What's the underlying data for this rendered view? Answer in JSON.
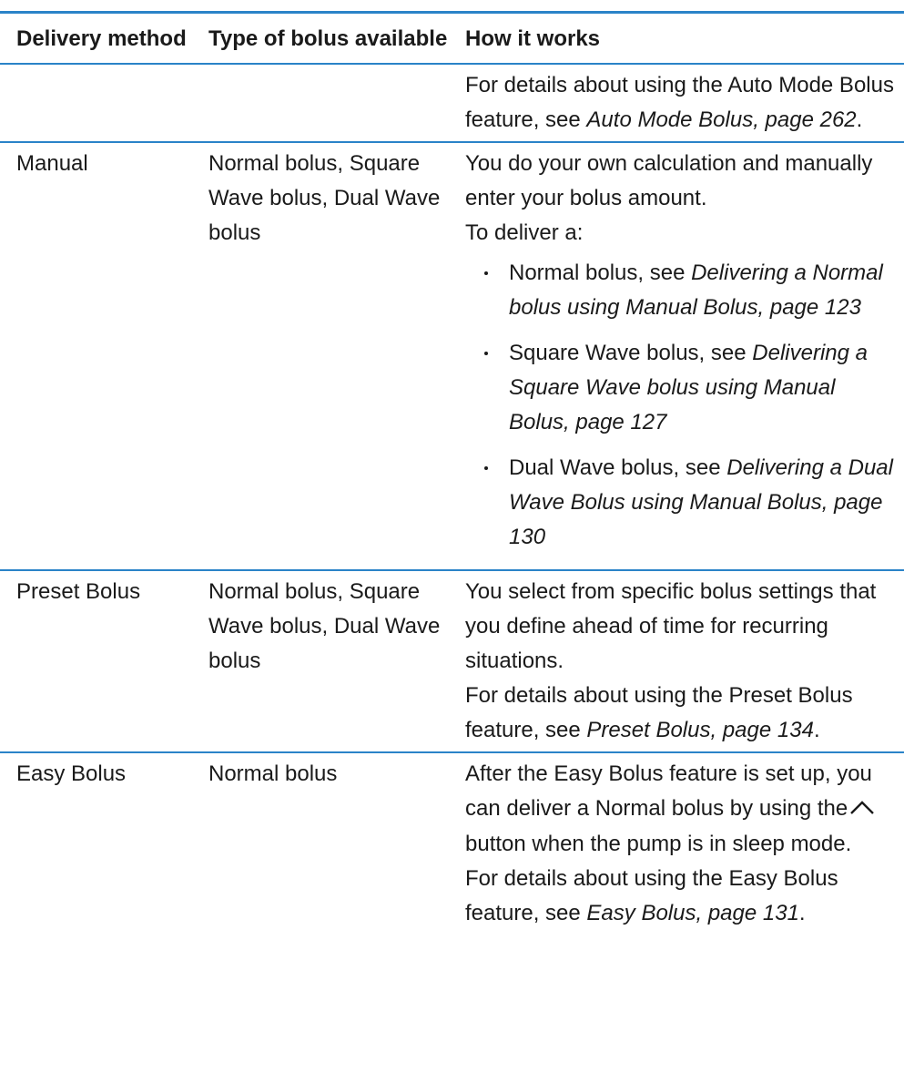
{
  "headers": [
    "Delivery method",
    "Type of bolus available",
    "How it works"
  ],
  "rows": [
    {
      "method": "",
      "types": "",
      "how": [
        {
          "pre": "For details about using the Auto Mode Bolus feature, see ",
          "ref": "Auto Mode Bolus, page 262",
          "post": "."
        }
      ]
    },
    {
      "method": "Manual",
      "types": "Normal bolus, Square Wave bolus, Dual Wave bolus",
      "how": [
        {
          "text": "You do your own calculation and manually enter your bolus amount."
        },
        {
          "text": "To deliver a:"
        }
      ],
      "bullets": [
        {
          "pre": "Normal bolus, see ",
          "ref": "Delivering a Normal bolus using Manual Bolus, page 123"
        },
        {
          "pre": "Square Wave bolus, see ",
          "ref": "Delivering a Square Wave bolus using Manual Bolus, page 127"
        },
        {
          "pre": "Dual Wave bolus, see ",
          "ref": "Delivering a Dual Wave Bolus using Manual Bolus, page 130"
        }
      ]
    },
    {
      "method": "Preset Bolus",
      "types": "Normal bolus, Square Wave bolus, Dual Wave bolus",
      "how": [
        {
          "text": "You select from specific bolus settings that you define ahead of time for recurring situations."
        },
        {
          "pre": "For details about using the Preset Bolus feature, see ",
          "ref": "Preset Bolus, page 134",
          "post": "."
        }
      ]
    },
    {
      "method": "Easy Bolus",
      "types": "Normal bolus",
      "how": [
        {
          "pre": "After the Easy Bolus feature is set up, you can deliver a Normal bolus by using the",
          "icon": "up-chevron-icon",
          "post": " button when the pump is in sleep mode."
        },
        {
          "pre": "For details about using the Easy Bolus feature, see ",
          "ref": "Easy Bolus, page 131",
          "post": "."
        }
      ]
    }
  ],
  "colors": {
    "rule": "#2a83c8",
    "text": "#1a1a1a"
  }
}
